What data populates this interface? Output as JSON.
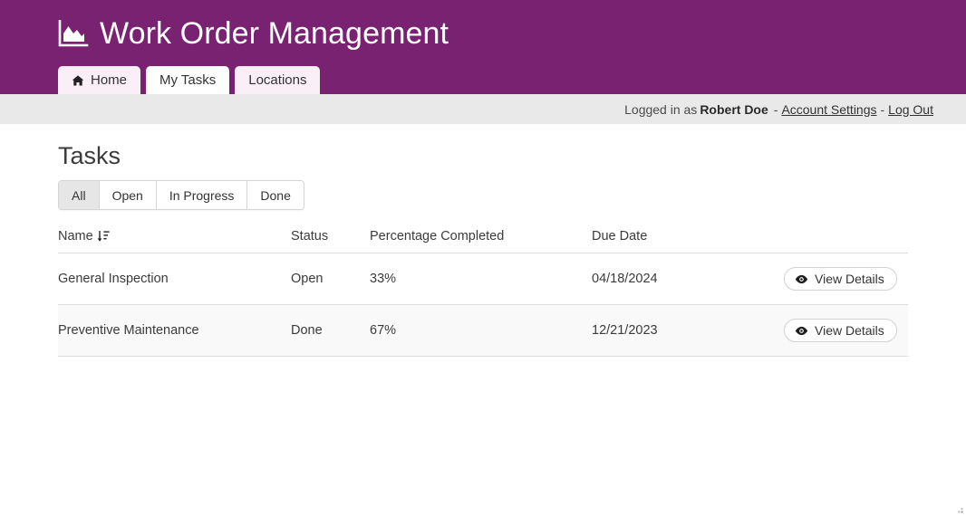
{
  "header": {
    "title": "Work Order Management",
    "logo_icon": "area-chart-icon",
    "background_color": "#7a2272"
  },
  "tabs": [
    {
      "label": "Home",
      "icon": "home-icon",
      "active": false
    },
    {
      "label": "My Tasks",
      "icon": "",
      "active": true
    },
    {
      "label": "Locations",
      "icon": "",
      "active": false
    }
  ],
  "userbar": {
    "logged_in_prefix": "Logged in as",
    "user_name": "Robert Doe",
    "separator": "-",
    "account_settings_label": "Account Settings",
    "log_out_label": "Log Out"
  },
  "main": {
    "page_title": "Tasks",
    "filters": [
      {
        "label": "All",
        "active": true
      },
      {
        "label": "Open",
        "active": false
      },
      {
        "label": "In Progress",
        "active": false
      },
      {
        "label": "Done",
        "active": false
      }
    ],
    "table": {
      "columns": [
        "Name",
        "Status",
        "Percentage Completed",
        "Due Date",
        ""
      ],
      "sort_column": "Name",
      "sort_icon": "sort-descending-icon",
      "rows": [
        {
          "name": "General Inspection",
          "status": "Open",
          "percentage_completed": "33%",
          "due_date": "04/18/2024",
          "action_label": "View Details",
          "action_icon": "eye-icon"
        },
        {
          "name": "Preventive Maintenance",
          "status": "Done",
          "percentage_completed": "67%",
          "due_date": "12/21/2023",
          "action_label": "View Details",
          "action_icon": "eye-icon"
        }
      ]
    }
  }
}
